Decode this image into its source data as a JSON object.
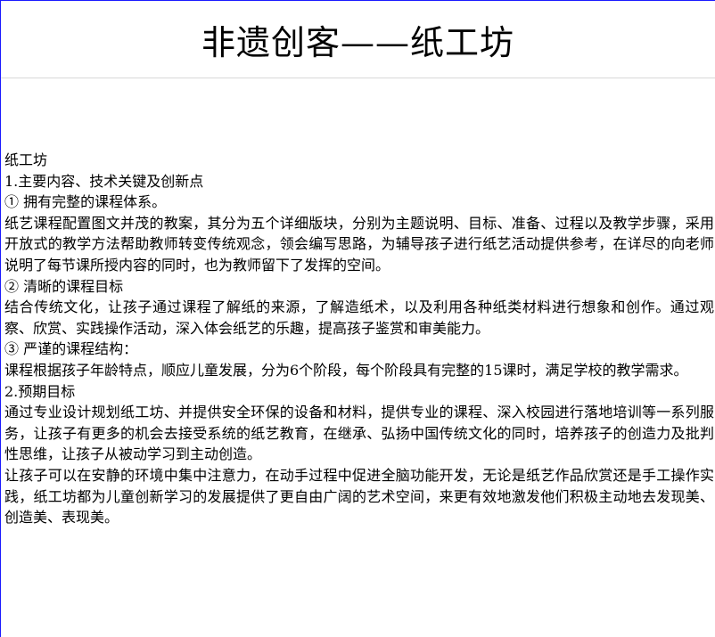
{
  "header": {
    "title": "非遗创客——纸工坊"
  },
  "article": {
    "paragraphs": [
      "纸工坊",
      "1.主要内容、技术关键及创新点",
      "① 拥有完整的课程体系。",
      "纸艺课程配置图文并茂的教案，其分为五个详细版块，分别为主题说明、目标、准备、过程以及教学步骤，采用开放式的教学方法帮助教师转变传统观念，领会编写思路，为辅导孩子进行纸艺活动提供参考，在详尽的向老师说明了每节课所授内容的同时，也为教师留下了发挥的空间。",
      "② 清晰的课程目标",
      "结合传统文化，让孩子通过课程了解纸的来源，了解造纸术，以及利用各种纸类材料进行想象和创作。通过观察、欣赏、实践操作活动，深入体会纸艺的乐趣，提高孩子鉴赏和审美能力。",
      "③ 严谨的课程结构：",
      "课程根据孩子年龄特点，顺应儿童发展，分为6个阶段，每个阶段具有完整的15课时，满足学校的教学需求。",
      "2.预期目标",
      "通过专业设计规划纸工坊、并提供安全环保的设备和材料，提供专业的课程、深入校园进行落地培训等一系列服务，让孩子有更多的机会去接受系统的纸艺教育，在继承、弘扬中国传统文化的同时，培养孩子的创造力及批判性思维，让孩子从被动学习到主动创造。",
      "让孩子可以在安静的环境中集中注意力，在动手过程中促进全脑功能开发，无论是纸艺作品欣赏还是手工操作实践，纸工坊都为儿童创新学习的发展提供了更自由广阔的艺术空间，来更有效地激发他们积极主动地去发现美、创造美、表现美。"
    ]
  }
}
